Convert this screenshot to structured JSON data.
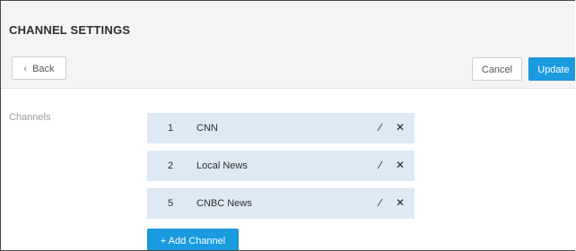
{
  "page": {
    "title": "CHANNEL SETTINGS"
  },
  "toolbar": {
    "back_label": "Back",
    "back_icon": "chevron-left-icon",
    "cancel_label": "Cancel",
    "update_label": "Update",
    "accent_color": "#1a9be0"
  },
  "channels": {
    "label": "Channels",
    "items": [
      {
        "number": "1",
        "name": "CNN"
      },
      {
        "number": "2",
        "name": "Local News"
      },
      {
        "number": "5",
        "name": "CNBC News"
      }
    ],
    "edit_icon": "pencil-icon",
    "delete_icon": "close-icon",
    "add_label": "+ Add Channel"
  }
}
